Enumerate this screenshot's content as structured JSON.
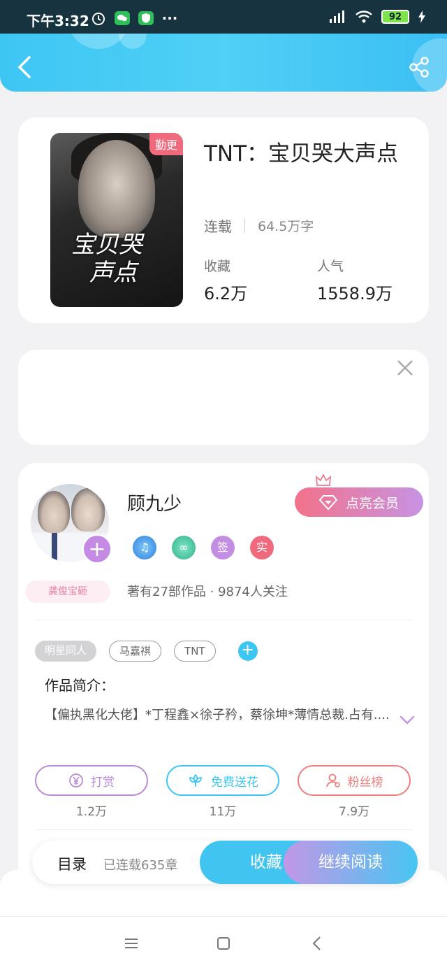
{
  "status_bar": {
    "time": "下午3:32",
    "battery": "92"
  },
  "book": {
    "cover_badge": "勤更",
    "cover_title_line1": "宝贝哭",
    "cover_title_line2": "声点",
    "title": "TNT：宝贝哭大声点",
    "status": "连载",
    "word_count": "64.5万字",
    "collect_label": "收藏",
    "collect_value": "6.2万",
    "popularity_label": "人气",
    "popularity_value": "1558.9万"
  },
  "author": {
    "name": "顾九少",
    "vip_button": "点亮会员",
    "fan_badge": "龚俊宝砸",
    "badges": [
      {
        "icon": "music-badge-icon",
        "text": "",
        "color": "#3b8de6"
      },
      {
        "icon": "handshake-badge-icon",
        "text": "",
        "color": "#37c6a0"
      },
      {
        "icon": "signed-badge-icon",
        "text": "签",
        "color": "#c48de4"
      },
      {
        "icon": "verified-badge-icon",
        "text": "实",
        "color": "#f06a7e"
      }
    ],
    "meta": "著有27部作品 · 9874人关注"
  },
  "tags": {
    "primary": "明星同人",
    "items": [
      "马嘉祺",
      "TNT"
    ]
  },
  "intro": {
    "label": "作品简介：",
    "text": "【偏执黑化大佬】*丁程鑫×徐子矜，蔡徐坤*薄情总裁.占有...."
  },
  "actions": [
    {
      "label": "打赏",
      "count": "1.2万",
      "color": "#b98ad6"
    },
    {
      "label": "免费送花",
      "count": "11万",
      "color": "#3ec6f3"
    },
    {
      "label": "粉丝榜",
      "count": "7.9万",
      "color": "#ef7d7d"
    }
  ],
  "bottom_bar": {
    "toc_label": "目录",
    "chapter_count": "已连载635章",
    "collect_button": "收藏",
    "read_button": "继续阅读"
  },
  "colors": {
    "header": "#3ec6f3",
    "vip_gradient_start": "#f3728a",
    "vip_gradient_end": "#c793e3"
  }
}
